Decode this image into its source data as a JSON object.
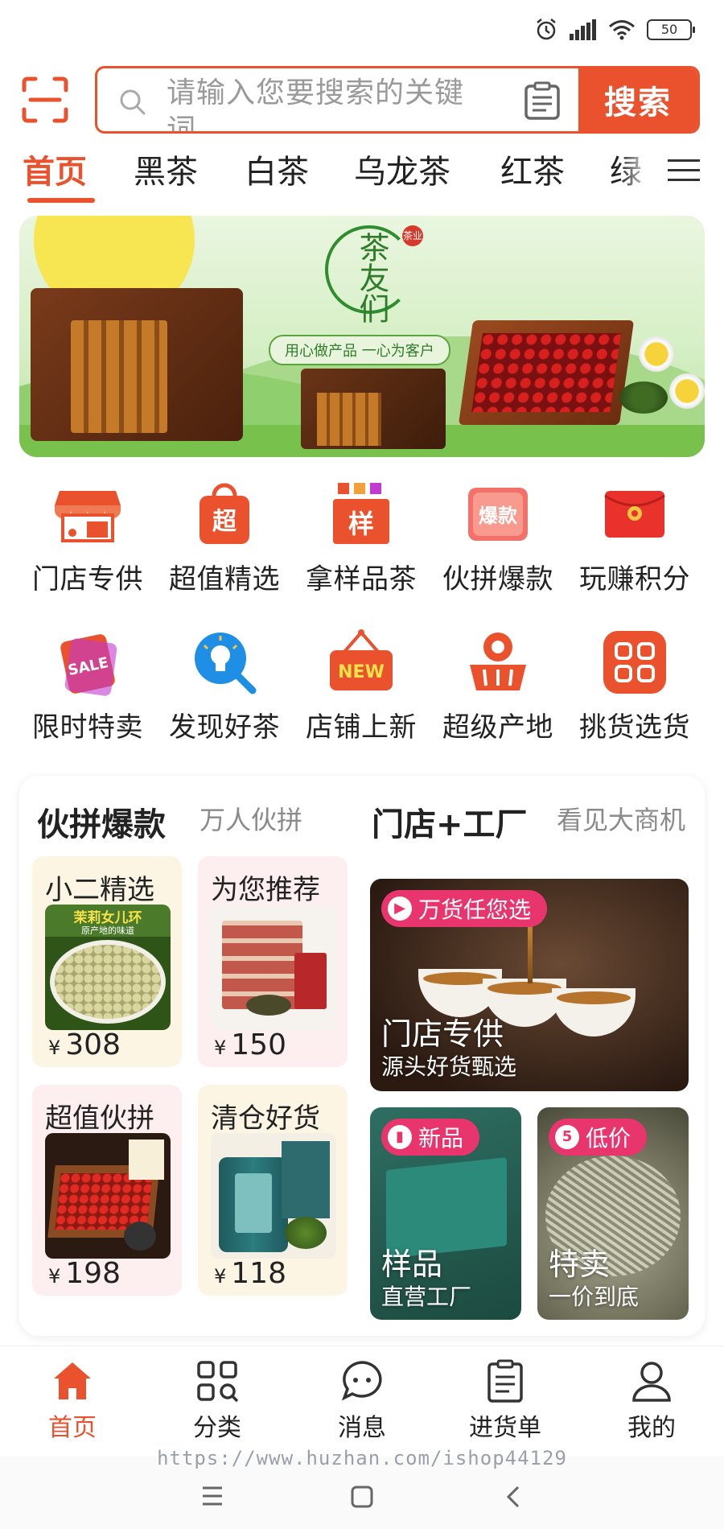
{
  "status_bar": {
    "battery": "50",
    "icons": [
      "alarm-icon",
      "signal-icon",
      "wifi-icon",
      "battery-icon"
    ]
  },
  "search": {
    "placeholder": "请输入您要搜索的关键词",
    "button_label": "搜索"
  },
  "tabs": [
    {
      "label": "首页",
      "active": true
    },
    {
      "label": "黑茶",
      "active": false
    },
    {
      "label": "白茶",
      "active": false
    },
    {
      "label": "乌龙茶",
      "active": false
    },
    {
      "label": "红茶",
      "active": false
    },
    {
      "label": "绿",
      "active": false
    }
  ],
  "banner": {
    "brand": "茶友们",
    "seal": "茶业",
    "slogan": "用心做产品 一心为客户"
  },
  "grid": [
    {
      "label": "门店专供",
      "icon": "storefront-icon"
    },
    {
      "label": "超值精选",
      "icon": "super-value-bag-icon"
    },
    {
      "label": "拿样品茶",
      "icon": "sample-icon"
    },
    {
      "label": "伙拼爆款",
      "icon": "hot-deal-icon"
    },
    {
      "label": "玩赚积分",
      "icon": "red-envelope-icon"
    },
    {
      "label": "限时特卖",
      "icon": "sale-tag-icon"
    },
    {
      "label": "发现好茶",
      "icon": "discover-bulb-icon"
    },
    {
      "label": "店铺上新",
      "icon": "new-sign-icon"
    },
    {
      "label": "超级产地",
      "icon": "basket-pin-icon"
    },
    {
      "label": "挑货选货",
      "icon": "select-goods-icon"
    }
  ],
  "group_buy": {
    "title": "伙拼爆款",
    "subtitle": "万人伙拼",
    "cards": [
      {
        "title": "小二精选",
        "price": "308",
        "currency": "¥",
        "image_text": "茉莉女儿环",
        "image_sub": "原产地的味道"
      },
      {
        "title": "为您推荐",
        "price": "150",
        "currency": "¥"
      },
      {
        "title": "超值伙拼",
        "price": "198",
        "currency": "¥"
      },
      {
        "title": "清仓好货",
        "price": "118",
        "currency": "¥"
      }
    ]
  },
  "factory": {
    "title": "门店+工厂",
    "subtitle": "看见大商机",
    "main_promo": {
      "tag": "万货任您选",
      "title": "门店专供",
      "subtitle": "源头好货甄选"
    },
    "promos": [
      {
        "tag": "新品",
        "title": "样品",
        "subtitle": "直营工厂"
      },
      {
        "tag": "低价",
        "tag_mark": "5",
        "title": "特卖",
        "subtitle": "一价到底"
      }
    ]
  },
  "bottom_nav": [
    {
      "label": "首页",
      "icon": "home-icon",
      "active": true
    },
    {
      "label": "分类",
      "icon": "category-icon",
      "active": false
    },
    {
      "label": "消息",
      "icon": "message-icon",
      "active": false
    },
    {
      "label": "进货单",
      "icon": "order-list-icon",
      "active": false
    },
    {
      "label": "我的",
      "icon": "profile-icon",
      "active": false
    }
  ],
  "watermark": "https://www.huzhan.com/ishop44129",
  "colors": {
    "accent": "#e9522c",
    "pink_tag": "#e9356d"
  }
}
